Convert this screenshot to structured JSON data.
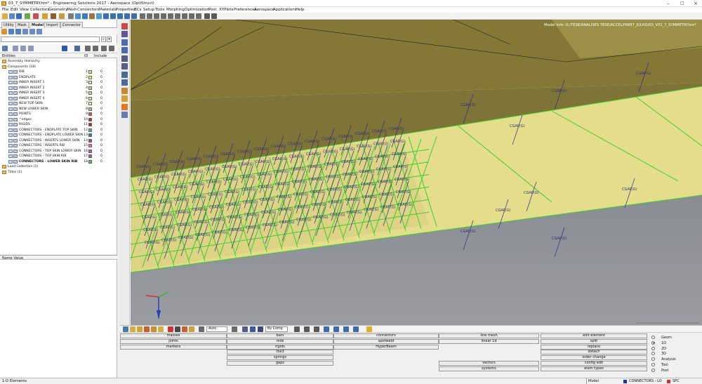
{
  "window": {
    "title": "03_7_SYMMETRY.hm* - Engineering Solutions 2017 - Aerospace (OptiStruct)"
  },
  "menu": [
    "File",
    "Edit",
    "View",
    "Collectors",
    "Geometry",
    "Mesh",
    "Connectors",
    "Materials",
    "Properties",
    "BCs",
    "Setup",
    "Tools",
    "Morphing",
    "Optimization",
    "Post",
    "XYPlots",
    "Preferences",
    "Aerospace",
    "Applications",
    "Help"
  ],
  "tabs": [
    "Utility",
    "Mask",
    "Model",
    "Import",
    "Connector"
  ],
  "browser": {
    "col_entities": "Entities",
    "col_id": "ID",
    "col_include": "Include",
    "tree": [
      {
        "label": "Assembly Hierarchy",
        "level": 0
      },
      {
        "label": "Components (18)",
        "level": 0
      }
    ],
    "components": [
      {
        "name": "RIB",
        "id": "1",
        "color": "#e8d87a"
      },
      {
        "name": "ENDPLATE",
        "id": "2",
        "color": "#f0e27c"
      },
      {
        "name": "INNER INSERT 1",
        "id": "3",
        "color": "#ede48a"
      },
      {
        "name": "INNER INSERT 2",
        "id": "4",
        "color": "#d9c96c"
      },
      {
        "name": "INNER INSERT 3",
        "id": "5",
        "color": "#efd07a"
      },
      {
        "name": "INNER INSERT 4",
        "id": "6",
        "color": "#e2e07c"
      },
      {
        "name": "NEW TOP SKIN",
        "id": "7",
        "color": "#f2ea8c"
      },
      {
        "name": "NEW LOWER SKIN",
        "id": "8",
        "color": "#b9b7ad"
      },
      {
        "name": "POINTS",
        "id": "9",
        "color": "#e05050"
      },
      {
        "name": "^edges",
        "id": "10",
        "color": "#d03030"
      },
      {
        "name": "RIGIDS",
        "id": "11",
        "color": "#b02828"
      },
      {
        "name": "CONNECTORS - ENDPLATE TOP SKIN",
        "id": "12",
        "color": "#4fa8c8"
      },
      {
        "name": "CONNECTORS - ENDPLATE LOWER SKIN",
        "id": "13",
        "color": "#3a7a8a"
      },
      {
        "name": "CONNECTORS - INSERTS LOWER SKIN",
        "id": "14",
        "color": "#b0409a"
      },
      {
        "name": "CONNECTORS - INSERTS RIB",
        "id": "15",
        "color": "#e070d0"
      },
      {
        "name": "CONNECTORS - TOP SKIN LOWER SKIN",
        "id": "16",
        "color": "#d050a0"
      },
      {
        "name": "CONNECTORS - TOP SKIN RIB",
        "id": "17",
        "color": "#9a58c8"
      },
      {
        "name": "CONNECTORS - LOWER SKIN RIB",
        "id": "18",
        "color": "#3ad03a"
      }
    ],
    "include_value": "0",
    "tree_after": [
      {
        "label": "Load Collectors (1)"
      },
      {
        "label": "Titles (1)"
      }
    ],
    "name_value_header": "Name  Value"
  },
  "viewport": {
    "model_info": "Model Info: D:/TESE/ANALISES TESE/ACCEL/HW87_JULHO/03_V01_7_SYMMETRY.hm*",
    "label": "CGAP(G)",
    "colors": {
      "top_surface": "#847735",
      "yellow_surface": "#e5de8d",
      "grey_surface": "#8e9097",
      "connector": "#2e2f78",
      "edge": "#3fcf2e"
    }
  },
  "bottom_toolbar": {
    "auto_label": "Auto",
    "bycomp_label": "By Comp"
  },
  "panel": {
    "col1": [
      "masses",
      "joints",
      "markers"
    ],
    "col2": [
      "bars",
      "rods",
      "rigids",
      "rbe3",
      "springs",
      "gaps"
    ],
    "col3": [
      "connectors",
      "spotweld",
      "HyperBeam"
    ],
    "col4": [
      "line mesh",
      "linear 1d",
      "",
      "",
      "",
      "vectors",
      "systems"
    ],
    "col5": [
      "edit element",
      "split",
      "replace",
      "detach",
      "order change",
      "config edit",
      "elem types"
    ],
    "radios": [
      "Geom",
      "1D",
      "2D",
      "3D",
      "Analysis",
      "Tool",
      "Post"
    ],
    "radio_selected": "1D"
  },
  "status": {
    "left": "1-D Elements",
    "mode": "Model",
    "component": "CONNECTORS - LO",
    "loadcol": "SPC"
  }
}
